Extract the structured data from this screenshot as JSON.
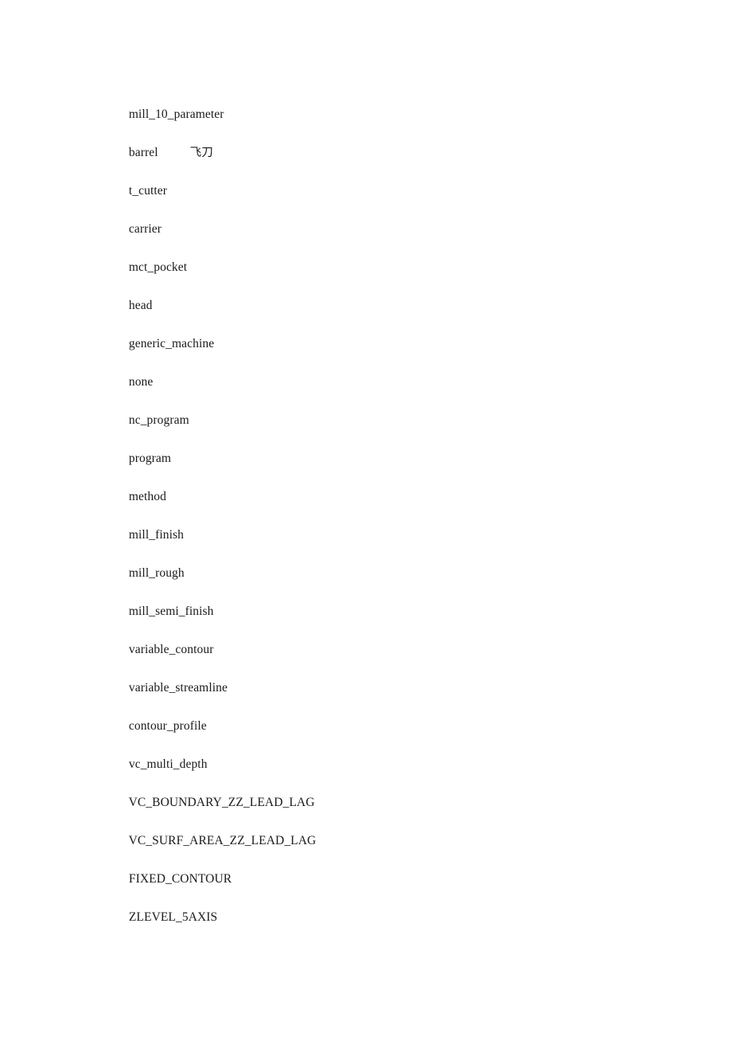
{
  "document": {
    "background_color": "#ffffff",
    "text_color": "#1a1a1a",
    "lines": [
      {
        "text": "mill_10_parameter",
        "annotation": ""
      },
      {
        "text": "barrel",
        "annotation": "飞刀"
      },
      {
        "text": "t_cutter",
        "annotation": ""
      },
      {
        "text": "carrier",
        "annotation": ""
      },
      {
        "text": "mct_pocket",
        "annotation": ""
      },
      {
        "text": "head",
        "annotation": ""
      },
      {
        "text": "generic_machine",
        "annotation": ""
      },
      {
        "text": "none",
        "annotation": ""
      },
      {
        "text": "nc_program",
        "annotation": ""
      },
      {
        "text": "program",
        "annotation": ""
      },
      {
        "text": "method",
        "annotation": ""
      },
      {
        "text": "mill_finish",
        "annotation": ""
      },
      {
        "text": "mill_rough",
        "annotation": ""
      },
      {
        "text": "mill_semi_finish",
        "annotation": ""
      },
      {
        "text": "variable_contour",
        "annotation": ""
      },
      {
        "text": "variable_streamline",
        "annotation": ""
      },
      {
        "text": "contour_profile",
        "annotation": ""
      },
      {
        "text": "vc_multi_depth",
        "annotation": ""
      },
      {
        "text": "VC_BOUNDARY_ZZ_LEAD_LAG",
        "annotation": ""
      },
      {
        "text": "VC_SURF_AREA_ZZ_LEAD_LAG",
        "annotation": ""
      },
      {
        "text": "FIXED_CONTOUR",
        "annotation": ""
      },
      {
        "text": "ZLEVEL_5AXIS",
        "annotation": ""
      }
    ]
  }
}
